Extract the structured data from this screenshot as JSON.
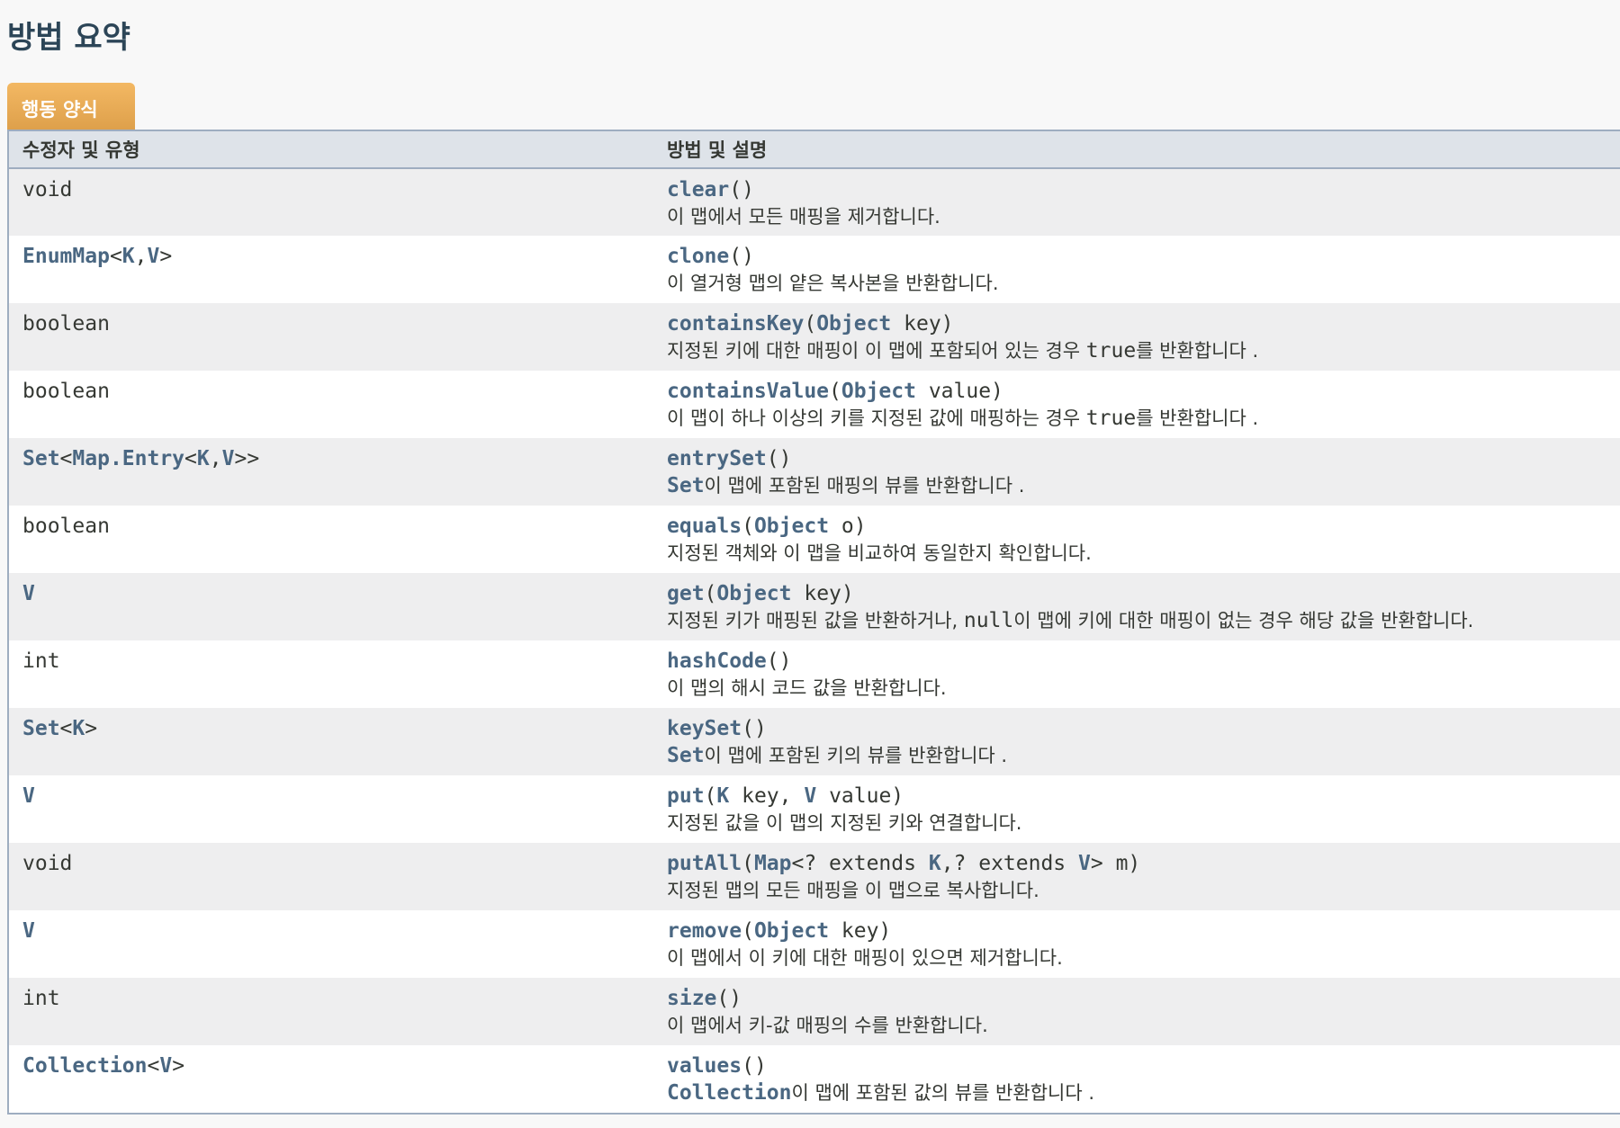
{
  "section_title": "방법 요약",
  "tab_label": "행동 양식",
  "table": {
    "headers": [
      "수정자 및 유형",
      "방법 및 설명"
    ],
    "rows": [
      {
        "type": [
          [
            "void",
            0
          ]
        ],
        "method": [
          [
            "clear",
            1
          ],
          [
            "()",
            0
          ]
        ],
        "desc": [
          [
            "이 맵에서 모든 매핑을 제거합니다.",
            2
          ]
        ]
      },
      {
        "type": [
          [
            "EnumMap",
            1
          ],
          [
            "<",
            0
          ],
          [
            "K",
            1
          ],
          [
            ",",
            0
          ],
          [
            "V",
            1
          ],
          [
            ">",
            0
          ]
        ],
        "method": [
          [
            "clone",
            1
          ],
          [
            "()",
            0
          ]
        ],
        "desc": [
          [
            "이 열거형 맵의 얕은 복사본을 반환합니다.",
            2
          ]
        ]
      },
      {
        "type": [
          [
            "boolean",
            0
          ]
        ],
        "method": [
          [
            "containsKey",
            1
          ],
          [
            "(",
            0
          ],
          [
            "Object",
            1
          ],
          [
            " key)",
            0
          ]
        ],
        "desc": [
          [
            "지정된 키에 대한 매핑이 이 맵에 포함되어 있는 경우 ",
            2
          ],
          [
            "true",
            3
          ],
          [
            "를 반환합니다 .",
            2
          ]
        ]
      },
      {
        "type": [
          [
            "boolean",
            0
          ]
        ],
        "method": [
          [
            "containsValue",
            1
          ],
          [
            "(",
            0
          ],
          [
            "Object",
            1
          ],
          [
            " value)",
            0
          ]
        ],
        "desc": [
          [
            "이 맵이 하나 이상의 키를 지정된 값에 매핑하는 경우 ",
            2
          ],
          [
            "true",
            3
          ],
          [
            "를 반환합니다 .",
            2
          ]
        ]
      },
      {
        "type": [
          [
            "Set",
            1
          ],
          [
            "<",
            0
          ],
          [
            "Map.Entry",
            1
          ],
          [
            "<",
            0
          ],
          [
            "K",
            1
          ],
          [
            ",",
            0
          ],
          [
            "V",
            1
          ],
          [
            ">>",
            0
          ]
        ],
        "method": [
          [
            "entrySet",
            1
          ],
          [
            "()",
            0
          ]
        ],
        "desc": [
          [
            "Set",
            4
          ],
          [
            "이 맵에 포함된 매핑의 뷰를 반환합니다 .",
            2
          ]
        ]
      },
      {
        "type": [
          [
            "boolean",
            0
          ]
        ],
        "method": [
          [
            "equals",
            1
          ],
          [
            "(",
            0
          ],
          [
            "Object",
            1
          ],
          [
            " o)",
            0
          ]
        ],
        "desc": [
          [
            "지정된 객체와 이 맵을 비교하여 동일한지 확인합니다.",
            2
          ]
        ]
      },
      {
        "type": [
          [
            "V",
            1
          ]
        ],
        "method": [
          [
            "get",
            1
          ],
          [
            "(",
            0
          ],
          [
            "Object",
            1
          ],
          [
            " key)",
            0
          ]
        ],
        "desc": [
          [
            "지정된 키가 매핑된 값을 반환하거나, ",
            2
          ],
          [
            "null",
            3
          ],
          [
            "이 맵에 키에 대한 매핑이 없는 경우 해당 값을 반환합니다.",
            2
          ]
        ]
      },
      {
        "type": [
          [
            "int",
            0
          ]
        ],
        "method": [
          [
            "hashCode",
            1
          ],
          [
            "()",
            0
          ]
        ],
        "desc": [
          [
            "이 맵의 해시 코드 값을 반환합니다.",
            2
          ]
        ]
      },
      {
        "type": [
          [
            "Set",
            1
          ],
          [
            "<",
            0
          ],
          [
            "K",
            1
          ],
          [
            ">",
            0
          ]
        ],
        "method": [
          [
            "keySet",
            1
          ],
          [
            "()",
            0
          ]
        ],
        "desc": [
          [
            "Set",
            4
          ],
          [
            "이 맵에 포함된 키의 뷰를 반환합니다 .",
            2
          ]
        ]
      },
      {
        "type": [
          [
            "V",
            1
          ]
        ],
        "method": [
          [
            "put",
            1
          ],
          [
            "(",
            0
          ],
          [
            "K",
            1
          ],
          [
            " key, ",
            0
          ],
          [
            "V",
            1
          ],
          [
            " value)",
            0
          ]
        ],
        "desc": [
          [
            "지정된 값을 이 맵의 지정된 키와 연결합니다.",
            2
          ]
        ]
      },
      {
        "type": [
          [
            "void",
            0
          ]
        ],
        "method": [
          [
            "putAll",
            1
          ],
          [
            "(",
            0
          ],
          [
            "Map",
            1
          ],
          [
            "<? extends ",
            0
          ],
          [
            "K",
            1
          ],
          [
            ",? extends ",
            0
          ],
          [
            "V",
            1
          ],
          [
            "> m)",
            0
          ]
        ],
        "desc": [
          [
            "지정된 맵의 모든 매핑을 이 맵으로 복사합니다.",
            2
          ]
        ]
      },
      {
        "type": [
          [
            "V",
            1
          ]
        ],
        "method": [
          [
            "remove",
            1
          ],
          [
            "(",
            0
          ],
          [
            "Object",
            1
          ],
          [
            " key)",
            0
          ]
        ],
        "desc": [
          [
            "이 맵에서 이 키에 대한 매핑이 있으면 제거합니다.",
            2
          ]
        ]
      },
      {
        "type": [
          [
            "int",
            0
          ]
        ],
        "method": [
          [
            "size",
            1
          ],
          [
            "()",
            0
          ]
        ],
        "desc": [
          [
            "이 맵에서 키-값 매핑의 수를 반환합니다.",
            2
          ]
        ]
      },
      {
        "type": [
          [
            "Collection",
            1
          ],
          [
            "<",
            0
          ],
          [
            "V",
            1
          ],
          [
            ">",
            0
          ]
        ],
        "method": [
          [
            "values",
            1
          ],
          [
            "()",
            0
          ]
        ],
        "desc": [
          [
            "Collection",
            4
          ],
          [
            "이 맵에 포함된 값의 뷰를 반환합니다 .",
            2
          ]
        ]
      }
    ]
  }
}
